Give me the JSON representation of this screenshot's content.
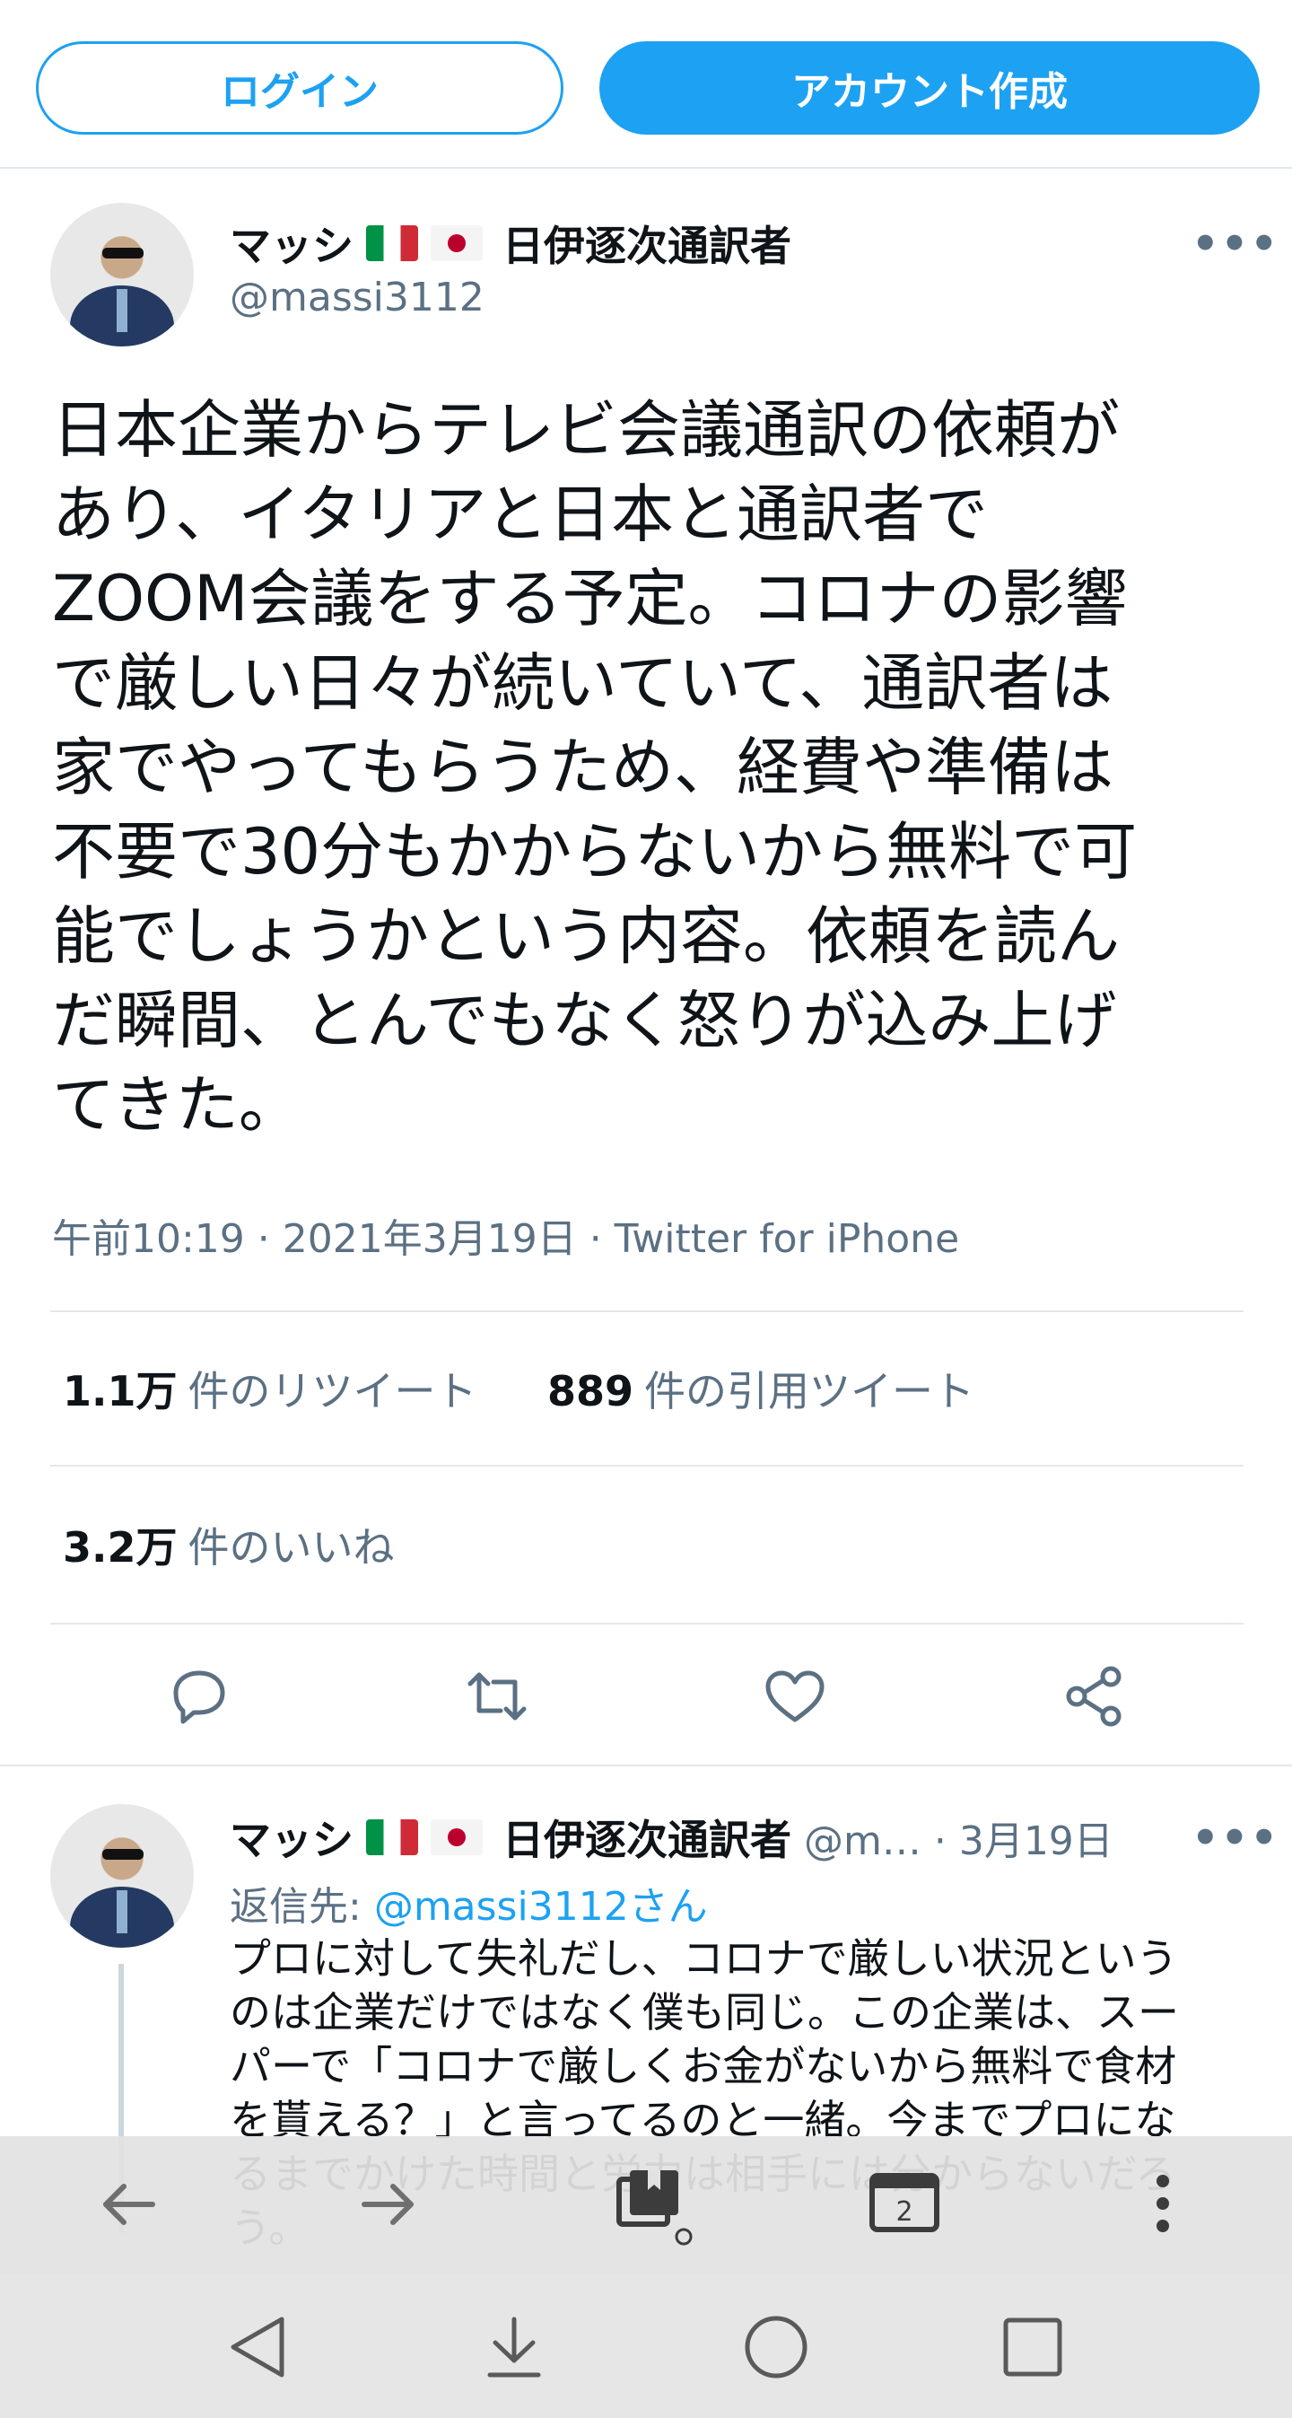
{
  "top_buttons": {
    "login": "ログイン",
    "signup": "アカウント作成"
  },
  "tweet": {
    "name_prefix": "マッシ",
    "name_suffix": "日伊逐次通訳者",
    "handle": "@massi3112",
    "more": "•••",
    "body": "日本企業からテレビ会議通訳の依頼が\nあり、イタリアと日本と通訳者で\nZOOM会議をする予定。コロナの影響\nで厳しい日々が続いていて、通訳者は\n家でやってもらうため、経費や準備は\n不要で30分もかからないから無料で可\n能でしょうかという内容。依頼を読ん\nだ瞬間、とんでもなく怒りが込み上げ\nてきた。",
    "meta": "午前10:19 · 2021年3月19日 · Twitter for iPhone",
    "retweets_count": "1.1万",
    "retweets_label": "件のリツイート",
    "quotes_count": "889",
    "quotes_label": "件の引用ツイート",
    "likes_count": "3.2万",
    "likes_label": "件のいいね"
  },
  "reply": {
    "name_prefix": "マッシ",
    "name_suffix": "日伊逐次通訳者",
    "meta": "@m… · 3月19日",
    "reply_to_prefix": "返信先: ",
    "reply_to_handle": "@massi3112",
    "reply_to_suffix": "さん",
    "body": "プロに対して失礼だし、コロナで厳しい状況という\nのは企業だけではなく僕も同じ。この企業は、スー\nパーで「コロナで厳しくお金がないから無料で食材\nを貰える？」と言ってるのと一緒。今までプロにな\nるまでかけた時間と労力は相手には分からないだろ\nう。"
  },
  "browser": {
    "tab_count": "2"
  },
  "icons": {
    "actions": [
      "reply-icon",
      "retweet-icon",
      "like-icon",
      "share-icon"
    ],
    "browser": [
      "back-arrow-icon",
      "forward-arrow-icon",
      "bookmarks-history-icon",
      "tabs-icon",
      "menu-dots-icon"
    ],
    "system": [
      "back-triangle-icon",
      "download-icon",
      "home-circle-icon",
      "recents-square-icon"
    ]
  },
  "colors": {
    "accent": "#1da1f2",
    "secondary_text": "#5b7083",
    "divider": "#e1e8ed"
  }
}
